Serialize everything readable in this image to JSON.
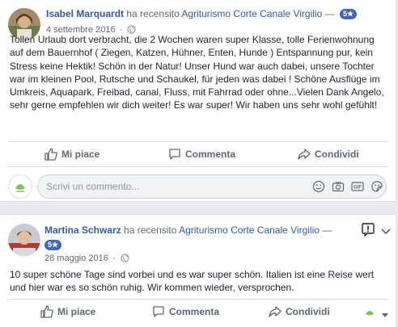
{
  "reviews": [
    {
      "author": "Isabel Marquardt",
      "action_text": "ha recensito",
      "page_name": "Agriturismo Corte Canale Virgilio",
      "separator": "—",
      "rating_badge": "5★",
      "date": "4 settembre 2016",
      "privacy_icon": "globe-icon",
      "text": "Tollen Urlaub dort verbracht, die 2 Wochen waren super Klasse, tolle Ferienwohnung auf dem Bauernhof ( Ziegen, Katzen, Hühner, Enten, Hunde ) Entspannung pur, kein Stress keine Hektik! Schön in der Natur! Unser Hund war auch dabei, unsere Tochter war im kleinen Pool, Rutsche und Schaukel, für jeden was dabei ! Schöne Ausflüge im Umkreis, Aquapark, Freibad, canal, Fluss, mit Fahrrad oder ohne...Vielen Dank Angelo, sehr gerne empfehlen wir dich weiter! Es war super! Wir haben uns sehr wohl gefühlt!"
    },
    {
      "author": "Martina Schwarz",
      "action_text": "ha recensito",
      "page_name": "Agriturismo Corte Canale Virgilio",
      "separator": "—",
      "rating_badge": "5★",
      "date": "28 maggio 2016",
      "privacy_icon": "globe-icon",
      "text": "10 super schöne Tage sind vorbei und es war super schön. Italien ist eine Reise wert und hier war es so schön ruhig. Wir kommen wieder, versprochen."
    }
  ],
  "actions": {
    "like": "Mi piace",
    "comment": "Commenta",
    "share": "Condividi"
  },
  "comment_box": {
    "placeholder": "Scrivi un commento...",
    "icons": [
      "emoji-icon",
      "camera-icon",
      "gif-icon",
      "sticker-icon"
    ]
  },
  "colors": {
    "link": "#365899",
    "badge": "#4267b2",
    "secondary_text": "#616770",
    "background": "#e9ebee"
  }
}
